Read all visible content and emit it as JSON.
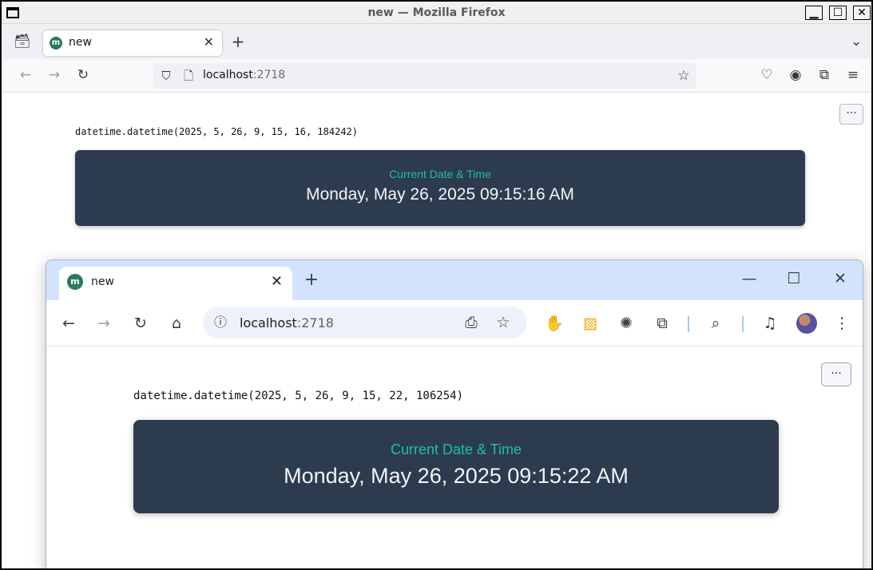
{
  "firefox": {
    "window_title": "new — Mozilla Firefox",
    "tab": {
      "label": "new",
      "favicon": "m"
    },
    "url": {
      "host": "localhost",
      "port": ":2718"
    },
    "page": {
      "code_output": "datetime.datetime(2025, 5, 26, 9, 15, 16, 184242)",
      "card_caption": "Current Date & Time",
      "card_value": "Monday, May 26, 2025 09:15:16 AM",
      "menu_dots": "···"
    }
  },
  "chrome": {
    "tab": {
      "label": "new",
      "favicon": "m"
    },
    "url": {
      "host": "localhost",
      "port": ":2718"
    },
    "page": {
      "code_output": "datetime.datetime(2025, 5, 26, 9, 15, 22, 106254)",
      "card_caption": "Current Date & Time",
      "card_value": "Monday, May 26, 2025 09:15:22 AM",
      "menu_dots": "···"
    }
  },
  "colors": {
    "card_bg": "#2d3b4f",
    "card_caption": "#1fbf9c",
    "card_text": "#f2f4f7",
    "chrome_tabstrip": "#d3e3fd"
  }
}
